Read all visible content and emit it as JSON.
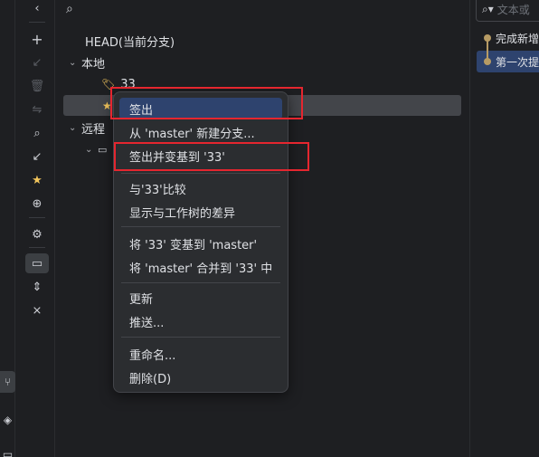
{
  "activity_bar": {
    "icons": [
      "branch-icon",
      "commit-icon",
      "terminal-icon"
    ]
  },
  "toolbar": {
    "icons": [
      "collapse-left-icon",
      "add-icon",
      "update-icon",
      "delete-icon",
      "compare-icon",
      "search-icon",
      "fetch-icon",
      "favorite-star-icon",
      "locate-icon",
      "settings-icon",
      "group-by-directory-icon",
      "expand-all-icon",
      "collapse-all-icon"
    ]
  },
  "tree": {
    "head_label": "HEAD(当前分支)",
    "local_label": "本地",
    "tag_label": "33",
    "remote_label": "远程"
  },
  "right_panel": {
    "search_placeholder": "文本或",
    "commits": [
      "完成新增",
      "第一次提"
    ]
  },
  "context_menu": {
    "checkout": "签出",
    "new_branch_from": "从 'master' 新建分支...",
    "checkout_rebase": "签出并变基到 '33'",
    "compare_with": "与'33'比较",
    "show_diff": "显示与工作树的差异",
    "rebase_onto": "将 '33' 变基到 'master'",
    "merge_into": "将 'master' 合并到 '33' 中",
    "update": "更新",
    "push": "推送...",
    "rename": "重命名...",
    "delete": "删除(D)"
  },
  "colors": {
    "highlight": "#2e436e",
    "annotation_red": "#e5262f",
    "star": "#f2c55c"
  }
}
